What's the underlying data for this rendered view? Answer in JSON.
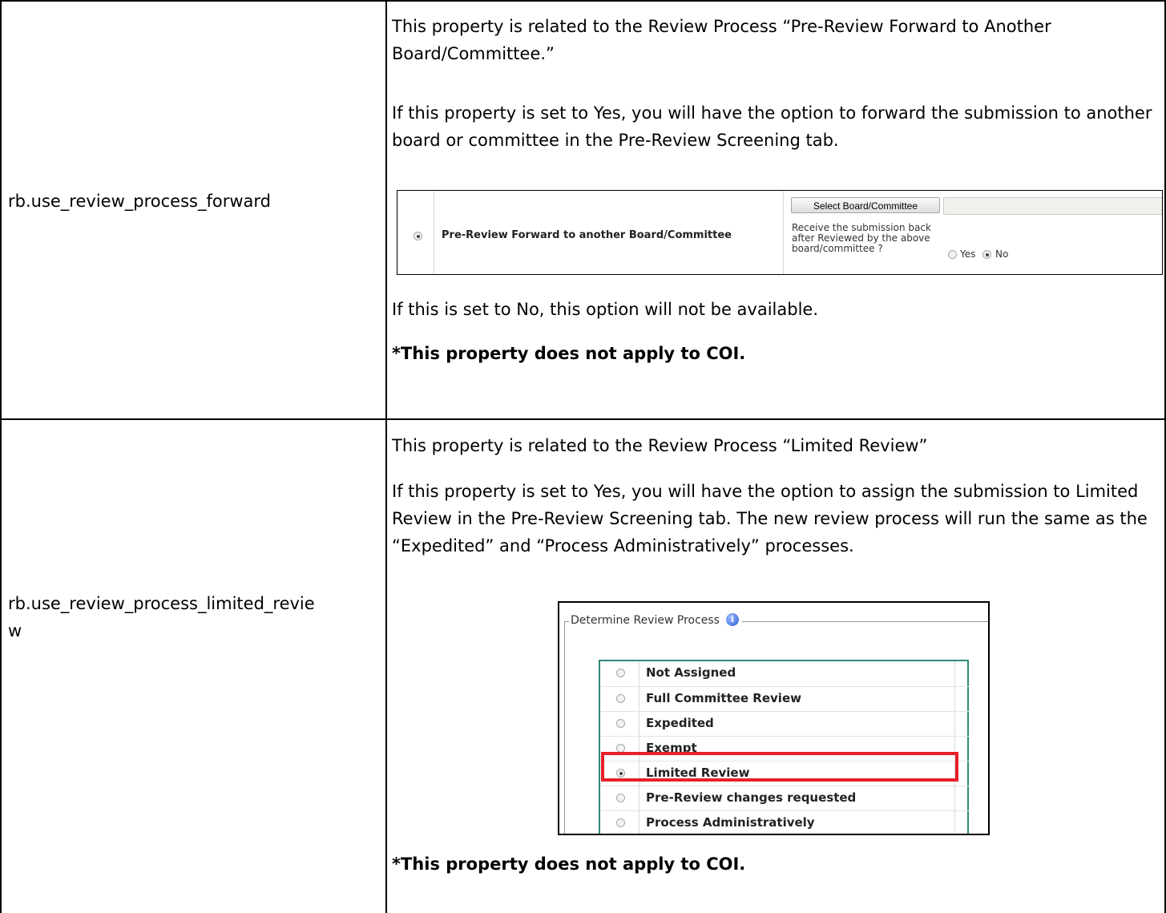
{
  "rows": [
    {
      "property": "rb.use_review_process_forward",
      "intro": "This property is related to the Review Process “Pre-Review Forward to Another Board/Committee.”",
      "detail": "If this property is set to Yes, you will have the option to forward the submission to another board or committee in the Pre-Review Screening tab.",
      "screenshot": {
        "option_label": "Pre-Review Forward to another Board/Committee",
        "select_button": "Select Board/Committee",
        "question": "Receive the submission back after Reviewed by the above board/committee ?",
        "yes_label": "Yes",
        "no_label": "No",
        "selected_answer": "No"
      },
      "after": "If this is set to No, this option will not be available.",
      "note": "*This property does not apply to COI."
    },
    {
      "property_line1": "rb.use_review_process_limited_revie",
      "property_line2": "w",
      "intro": "This property is related to the Review Process “Limited Review”",
      "detail": "If this property is set to Yes, you will have the option to assign the submission to Limited Review in the Pre-Review Screening tab. The new review process will run the same as the “Expedited” and “Process Administratively” processes.",
      "screenshot": {
        "legend": "Determine Review Process",
        "options": [
          "Not Assigned",
          "Full Committee Review",
          "Expedited",
          "Exempt",
          "Limited Review",
          "Pre-Review changes requested",
          "Process Administratively"
        ],
        "selected": "Limited Review",
        "highlight_color": "#e8202a"
      },
      "note": "*This property does not apply to COI."
    }
  ]
}
